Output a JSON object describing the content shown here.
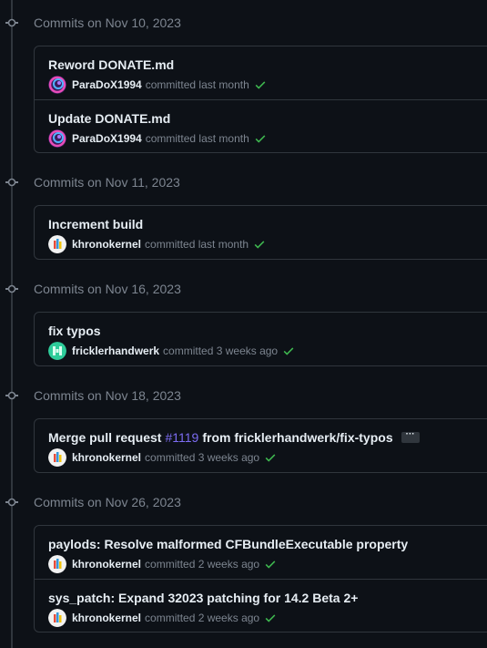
{
  "groups": [
    {
      "title": "Commits on Nov 10, 2023",
      "commits": [
        {
          "message": "Reword DONATE.md",
          "author": "ParaDoX1994",
          "time": "committed last month",
          "avatar": "paradox"
        },
        {
          "message": "Update DONATE.md",
          "author": "ParaDoX1994",
          "time": "committed last month",
          "avatar": "paradox"
        }
      ]
    },
    {
      "title": "Commits on Nov 11, 2023",
      "commits": [
        {
          "message": "Increment build",
          "author": "khronokernel",
          "time": "committed last month",
          "avatar": "khrono"
        }
      ]
    },
    {
      "title": "Commits on Nov 16, 2023",
      "commits": [
        {
          "message": "fix typos",
          "author": "fricklerhandwerk",
          "time": "committed 3 weeks ago",
          "avatar": "frickler"
        }
      ]
    },
    {
      "title": "Commits on Nov 18, 2023",
      "commits": [
        {
          "message_prefix": "Merge pull request",
          "pr_link": "#1119",
          "message_suffix": "from fricklerhandwerk/fix-typos",
          "ellipsis": "···",
          "author": "khronokernel",
          "time": "committed 3 weeks ago",
          "avatar": "khrono"
        }
      ]
    },
    {
      "title": "Commits on Nov 26, 2023",
      "commits": [
        {
          "message": "paylods: Resolve malformed CFBundleExecutable property",
          "author": "khronokernel",
          "time": "committed 2 weeks ago",
          "avatar": "khrono"
        },
        {
          "message": "sys_patch: Expand 32023 patching for 14.2 Beta 2+",
          "author": "khronokernel",
          "time": "committed 2 weeks ago",
          "avatar": "khrono"
        }
      ]
    }
  ],
  "colors": {
    "background": "#0d1117",
    "border": "#30363d",
    "muted_text": "#7d8590",
    "check_green": "#3fb950",
    "pr_link": "#7c6cf2"
  },
  "icons": {
    "status": "check-icon",
    "node": "git-commit-icon"
  }
}
